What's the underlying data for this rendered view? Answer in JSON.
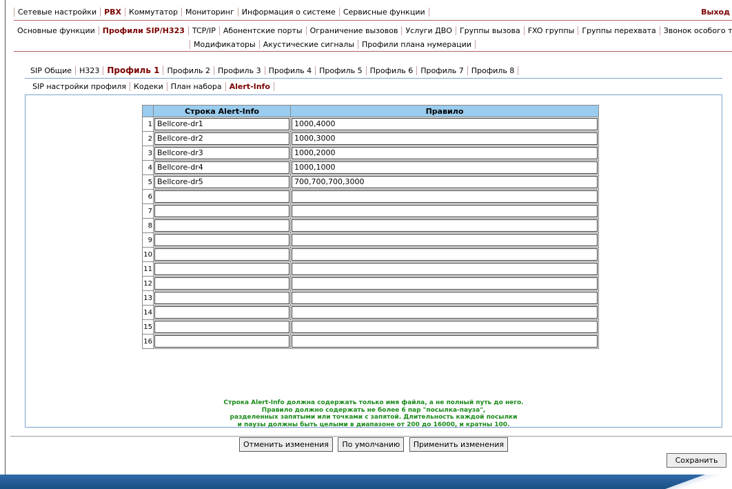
{
  "top_menu": {
    "items": [
      "Сетевые настройки",
      "PBX",
      "Коммутатор",
      "Мониторинг",
      "Информация о системе",
      "Сервисные функции"
    ],
    "active": "PBX",
    "exit_label": "Выход"
  },
  "sub_menu": {
    "row1": [
      "Основные функции",
      "Профили SIP/H323",
      "TCP/IP",
      "Абонентские порты",
      "Ограничение вызовов",
      "Услуги ДВО",
      "Группы вызова",
      "FXO группы",
      "Группы перехвата",
      "Звонок особого типа"
    ],
    "row2": [
      "Модификаторы",
      "Акустические сигналы",
      "Профили плана нумерации"
    ],
    "active": "Профили SIP/H323"
  },
  "profile_tabs": {
    "items": [
      "SIP Общие",
      "H323",
      "Профиль 1",
      "Профиль 2",
      "Профиль 3",
      "Профиль 4",
      "Профиль 5",
      "Профиль 6",
      "Профиль 7",
      "Профиль 8"
    ],
    "active": "Профиль 1"
  },
  "sub_tabs": {
    "items": [
      "SIP настройки профиля",
      "Кодеки",
      "План набора",
      "Alert-Info"
    ],
    "active": "Alert-Info"
  },
  "table": {
    "headers": [
      "Строка Alert-Info",
      "Правило"
    ],
    "rows": [
      {
        "n": "1",
        "alert": "Bellcore-dr1",
        "rule": "1000,4000"
      },
      {
        "n": "2",
        "alert": "Bellcore-dr2",
        "rule": "1000,3000"
      },
      {
        "n": "3",
        "alert": "Bellcore-dr3",
        "rule": "1000,2000"
      },
      {
        "n": "4",
        "alert": "Bellcore-dr4",
        "rule": "1000,1000"
      },
      {
        "n": "5",
        "alert": "Bellcore-dr5",
        "rule": "700,700,700,3000"
      },
      {
        "n": "6",
        "alert": "",
        "rule": ""
      },
      {
        "n": "7",
        "alert": "",
        "rule": ""
      },
      {
        "n": "8",
        "alert": "",
        "rule": ""
      },
      {
        "n": "9",
        "alert": "",
        "rule": ""
      },
      {
        "n": "10",
        "alert": "",
        "rule": ""
      },
      {
        "n": "11",
        "alert": "",
        "rule": ""
      },
      {
        "n": "12",
        "alert": "",
        "rule": ""
      },
      {
        "n": "13",
        "alert": "",
        "rule": ""
      },
      {
        "n": "14",
        "alert": "",
        "rule": ""
      },
      {
        "n": "15",
        "alert": "",
        "rule": ""
      },
      {
        "n": "16",
        "alert": "",
        "rule": ""
      }
    ]
  },
  "note": {
    "lines": [
      "Строка Alert-Info должна содержать только имя файла, а не полный путь до него.",
      "Правило должно содержать не более 6 пар \"посылка-пауза\",",
      "разделенных запятыми или точками с запятой. Длительность каждой посылки",
      "и паузы должны быть целыми в диапазоне от 200 до 16000, и кратны 100."
    ]
  },
  "buttons": {
    "cancel": "Отменить изменения",
    "default": "По умолчанию",
    "apply": "Применить изменения",
    "save": "Сохранить"
  },
  "colors": {
    "active_tab": "#7a0000",
    "header_bg": "#99ccee",
    "note_text": "#1a8a1a",
    "footer_bar": "#1b4f86"
  }
}
